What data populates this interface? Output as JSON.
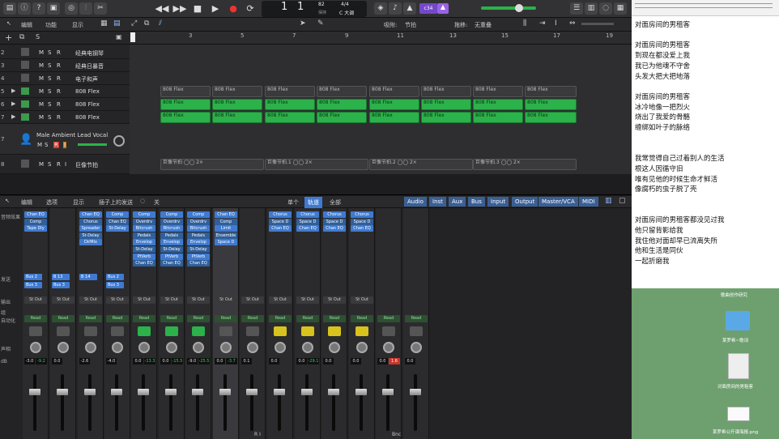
{
  "transport": {
    "bar": "1",
    "beat": "1",
    "tempo": "82",
    "tempo_label": "保持",
    "time_sig": "4/4",
    "key": "C 大调",
    "counter_label": "c34"
  },
  "arrange_bar": {
    "edit": "编辑",
    "function": "功能",
    "view": "显示",
    "snap_label": "吸附:",
    "snap_value": "节拍",
    "drag_label": "拖移:",
    "drag_value": "无重叠"
  },
  "ruler": [
    "3",
    "5",
    "7",
    "9",
    "11",
    "13",
    "15",
    "17",
    "19"
  ],
  "tracks": [
    {
      "num": "2",
      "name": "经典电钢琴"
    },
    {
      "num": "3",
      "name": "经典日暴音"
    },
    {
      "num": "4",
      "name": "电子和声"
    },
    {
      "num": "5",
      "name": "808 Flex"
    },
    {
      "num": "6",
      "name": "808 Flex"
    },
    {
      "num": "7",
      "name": "808 Flex"
    },
    {
      "num": "7",
      "name": "Male Ambient Lead Vocal"
    },
    {
      "num": "8",
      "name": "巨像节拍"
    }
  ],
  "track_buttons": {
    "m": "M",
    "s": "S",
    "r": "R",
    "i": "I"
  },
  "regions": {
    "flex_label": "808 Flex",
    "beat_regions": [
      "巨像节拍 ◯◯ 2×",
      "巨像节拍.1 ◯◯ 2×",
      "巨像节拍.2 ◯◯ 2×",
      "巨像节拍.3 ◯◯ 2×"
    ]
  },
  "mixer_bar": {
    "edit": "编辑",
    "options": "选项",
    "view": "显示",
    "sends": "插子上的发送",
    "off": "关",
    "single": "单个",
    "tracks": "轨道",
    "all": "全部",
    "filters": [
      "Audio",
      "Inst",
      "Aux",
      "Bus",
      "Input",
      "Output",
      "Master/VCA",
      "MIDI"
    ]
  },
  "mixer_rows": {
    "effects": "音频效果",
    "sends": "发送",
    "output": "输出",
    "group": "组",
    "automation": "自动化",
    "pan": "声相",
    "db": "dB"
  },
  "strips": [
    {
      "plugins": [
        "Chan EQ",
        "Comp",
        "Tape Dly"
      ],
      "sends": [
        "Bus 2",
        "Bus 3"
      ],
      "out": "St Out",
      "auto": "Read",
      "vol": "-3.0",
      "peak": "-9.2"
    },
    {
      "plugins": [],
      "sends": [
        "B 13",
        "Bus 3"
      ],
      "out": "St Out",
      "auto": "Read",
      "vol": "0.0",
      "peak": ""
    },
    {
      "plugins": [
        "Chan EQ",
        "Chorus",
        "Spreader",
        "St-Delay",
        "DirMix"
      ],
      "sends": [
        "B 14"
      ],
      "out": "St Out",
      "auto": "Read",
      "vol": "-2.6",
      "peak": ""
    },
    {
      "plugins": [
        "Comp",
        "Chan EQ",
        "St-Delay"
      ],
      "sends": [
        "Bus 2",
        "Bus 3"
      ],
      "out": "St Out",
      "auto": "Read",
      "vol": "-4.0",
      "peak": ""
    },
    {
      "plugins": [
        "Comp",
        "Overdrv",
        "Bitcrush",
        "Pedals",
        "Envelop",
        "St-Delay",
        "PtVerb",
        "Chan EQ"
      ],
      "sends": [],
      "out": "St Out",
      "auto": "Read",
      "vol": "0.0",
      "peak": "-13.3"
    },
    {
      "plugins": [
        "Comp",
        "Overdrv",
        "Bitcrush",
        "Pedals",
        "Envelop",
        "St-Delay",
        "PtVerb",
        "Chan EQ"
      ],
      "sends": [],
      "out": "St Out",
      "auto": "Read",
      "vol": "0.0",
      "peak": "-15.5"
    },
    {
      "plugins": [
        "Comp",
        "Overdrv",
        "Bitcrush",
        "Pedals",
        "Envelop",
        "St-Delay",
        "PtVerb",
        "Chan EQ"
      ],
      "sends": [],
      "out": "St Out",
      "auto": "Read",
      "vol": "-9.0",
      "peak": "-25.5"
    },
    {
      "plugins": [
        "Chan EQ",
        "Comp",
        "Limit",
        "Ensemble",
        "Space D"
      ],
      "sends": [],
      "out": "St Out",
      "auto": "Read",
      "vol": "0.0",
      "peak": "-3.7"
    },
    {
      "plugins": [],
      "sends": [],
      "out": "St Out",
      "auto": "Read",
      "vol": "0.1",
      "peak": ""
    },
    {
      "plugins": [
        "Chorus",
        "Space D",
        "Chan EQ"
      ],
      "sends": [],
      "out": "St Out",
      "auto": "Read",
      "vol": "0.0",
      "peak": ""
    },
    {
      "plugins": [
        "Chorus",
        "Space D",
        "Chan EQ"
      ],
      "sends": [],
      "out": "St Out",
      "auto": "Read",
      "vol": "0.0",
      "peak": "-29.1"
    },
    {
      "plugins": [
        "Chorus",
        "Space D",
        "Chan EQ"
      ],
      "sends": [],
      "out": "St Out",
      "auto": "Read",
      "vol": "0.0",
      "peak": ""
    },
    {
      "plugins": [
        "Chorus",
        "Space D",
        "Chan EQ"
      ],
      "sends": [],
      "out": "St Out",
      "auto": "Read",
      "vol": "0.0",
      "peak": ""
    },
    {
      "plugins": [],
      "sends": [],
      "out": "",
      "auto": "Read",
      "vol": "0.0",
      "peak": "1.6"
    },
    {
      "plugins": [],
      "sends": [],
      "out": "",
      "auto": "Read",
      "vol": "0.0",
      "peak": ""
    }
  ],
  "strip_footer": {
    "ri": "R I",
    "bnc": "Bnc"
  },
  "lyrics": [
    "对面房间的男租客",
    "",
    "对面房间的男租客",
    "到现在都没爱上我",
    "我已为他魂不守舍",
    "头发大把大把地落",
    "",
    "对面房间的男租客",
    "冰冷地像一把烈火",
    "烧出了我爱的骨骼",
    "缠绑如叶子的脉络",
    "",
    "",
    "我常觉得自己过着别人的生活",
    "根这人因循守旧",
    "唯有见他的时候生命才鲜活",
    "像腐朽的虫子脱了壳",
    "",
    "",
    "对面房间的男租客都没见过我",
    "他只留背影给我",
    "我住他对面却早已流离失所",
    "他和生活是同伙",
    "一起折磨我"
  ],
  "desktop": {
    "top_label": "歌曲创作研究",
    "folder_label": "某罗希~歌词",
    "file_label": "对面房间的男租客",
    "image_label": "某罗希公开课海报.png"
  },
  "colors": {
    "region_green": "#2bb24a",
    "plugin_blue": "#3f7ad0",
    "desktop_green": "#6ea06f"
  }
}
